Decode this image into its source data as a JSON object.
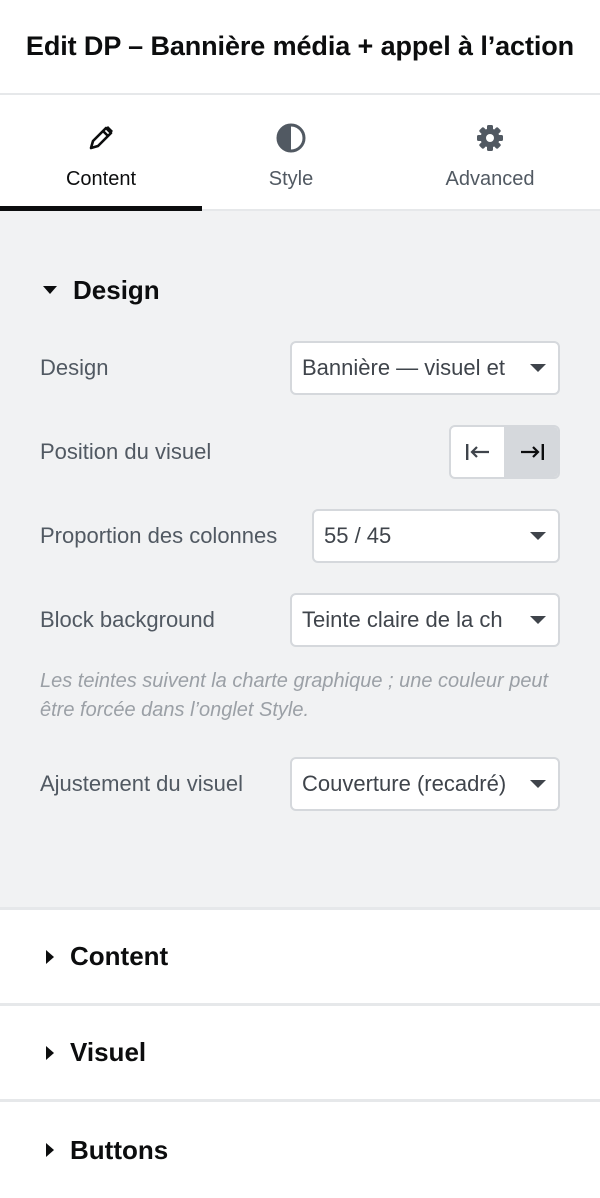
{
  "header": {
    "title": "Edit DP – Bannière média + appel à l’action"
  },
  "tabs": [
    {
      "label": "Content",
      "icon": "pencil-icon",
      "active": true
    },
    {
      "label": "Style",
      "icon": "half-circle-icon",
      "active": false
    },
    {
      "label": "Advanced",
      "icon": "gear-icon",
      "active": false
    }
  ],
  "design_section": {
    "title": "Design",
    "design": {
      "label": "Design",
      "value": "Bannière — visuel et"
    },
    "position": {
      "label": "Position du visuel",
      "options": [
        "align-left-icon",
        "align-right-icon"
      ],
      "selected": 1
    },
    "proportion": {
      "label": "Proportion des colonnes",
      "value": "55 / 45"
    },
    "background": {
      "label": "Block background",
      "value": "Teinte claire de la ch"
    },
    "hint": "Les teintes suivent la charte graphique ; une couleur peut être forcée dans l’onglet Style.",
    "fit": {
      "label": "Ajustement du visuel",
      "value": "Couverture (recadré)"
    }
  },
  "collapsed_sections": [
    {
      "title": "Content"
    },
    {
      "title": "Visuel"
    },
    {
      "title": "Buttons"
    }
  ],
  "colors": {
    "text": "#0c0d0e",
    "muted": "#515962",
    "panel": "#f1f2f3",
    "border": "#d5d8dc"
  }
}
